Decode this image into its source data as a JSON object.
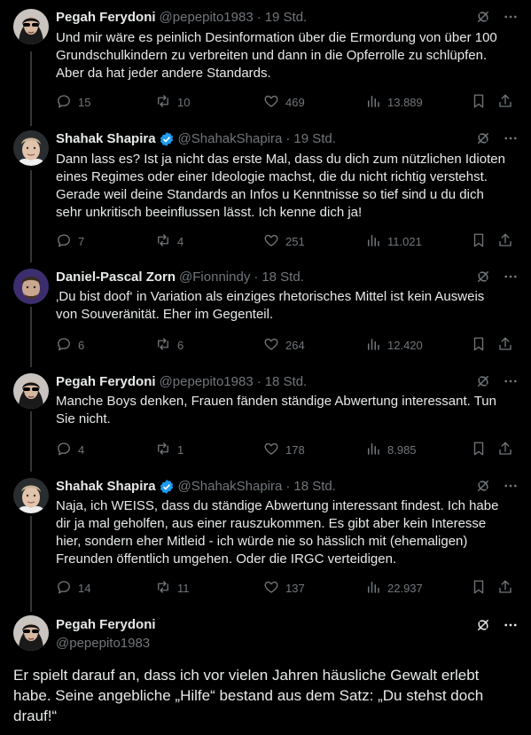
{
  "tweets": [
    {
      "name": "Pegah Ferydoni",
      "handle": "@pepepito1983",
      "time": "19 Std.",
      "verified": false,
      "lines": [
        "Und mir wäre es peinlich Desinformation über die Ermordung von über 100",
        "Grundschulkindern zu verbreiten und dann in die Opferrolle zu schlüpfen.",
        "Aber da hat jeder andere Standards."
      ],
      "replies": "15",
      "reposts": "10",
      "likes": "469",
      "views": "13.889"
    },
    {
      "name": "Shahak Shapira",
      "handle": "@ShahakShapira",
      "time": "19 Std.",
      "verified": true,
      "lines": [
        "Dann lass es? Ist ja nicht das erste Mal, dass du dich zum nützlichen Idioten",
        "eines Regimes oder einer Ideologie machst, die du nicht richtig verstehst.",
        "Gerade weil deine Standards an Infos u Kenntnisse so tief sind u du dich",
        "sehr unkritisch beeinflussen lässt. Ich kenne dich ja!"
      ],
      "replies": "7",
      "reposts": "4",
      "likes": "251",
      "views": "11.021"
    },
    {
      "name": "Daniel-Pascal Zorn",
      "handle": "@Fionnindy",
      "time": "18 Std.",
      "verified": false,
      "lines": [
        "‚Du bist doof‘ in Variation als einziges rhetorisches Mittel ist kein Ausweis",
        "von Souveränität. Eher im Gegenteil."
      ],
      "replies": "6",
      "reposts": "6",
      "likes": "264",
      "views": "12.420"
    },
    {
      "name": "Pegah Ferydoni",
      "handle": "@pepepito1983",
      "time": "18 Std.",
      "verified": false,
      "lines": [
        "Manche Boys denken, Frauen fänden ständige Abwertung interessant. Tun",
        "Sie nicht."
      ],
      "replies": "4",
      "reposts": "1",
      "likes": "178",
      "views": "8.985"
    },
    {
      "name": "Shahak Shapira",
      "handle": "@ShahakShapira",
      "time": "18 Std.",
      "verified": true,
      "lines": [
        "Naja, ich WEISS, dass du ständige Abwertung interessant findest. Ich habe",
        "dir ja mal geholfen, aus einer rauszukommen. Es gibt aber kein Interesse",
        "hier, sondern eher Mitleid - ich würde nie so hässlich mit (ehemaligen)",
        "Freunden öffentlich umgehen. Oder die IRGC verteidigen."
      ],
      "replies": "14",
      "reposts": "11",
      "likes": "137",
      "views": "22.937"
    }
  ],
  "main": {
    "name": "Pegah Ferydoni",
    "handle": "@pepepito1983",
    "text": "Er spielt darauf an, dass ich vor vielen Jahren häusliche Gewalt erlebt habe. Seine angebliche „Hilfe“ bestand aus dem Satz: „Du stehst doch drauf!“"
  },
  "colors": {
    "background": "#000000",
    "text": "#e7e9ea",
    "muted": "#71767b",
    "verified": "#1d9bf0",
    "line": "#333639"
  }
}
